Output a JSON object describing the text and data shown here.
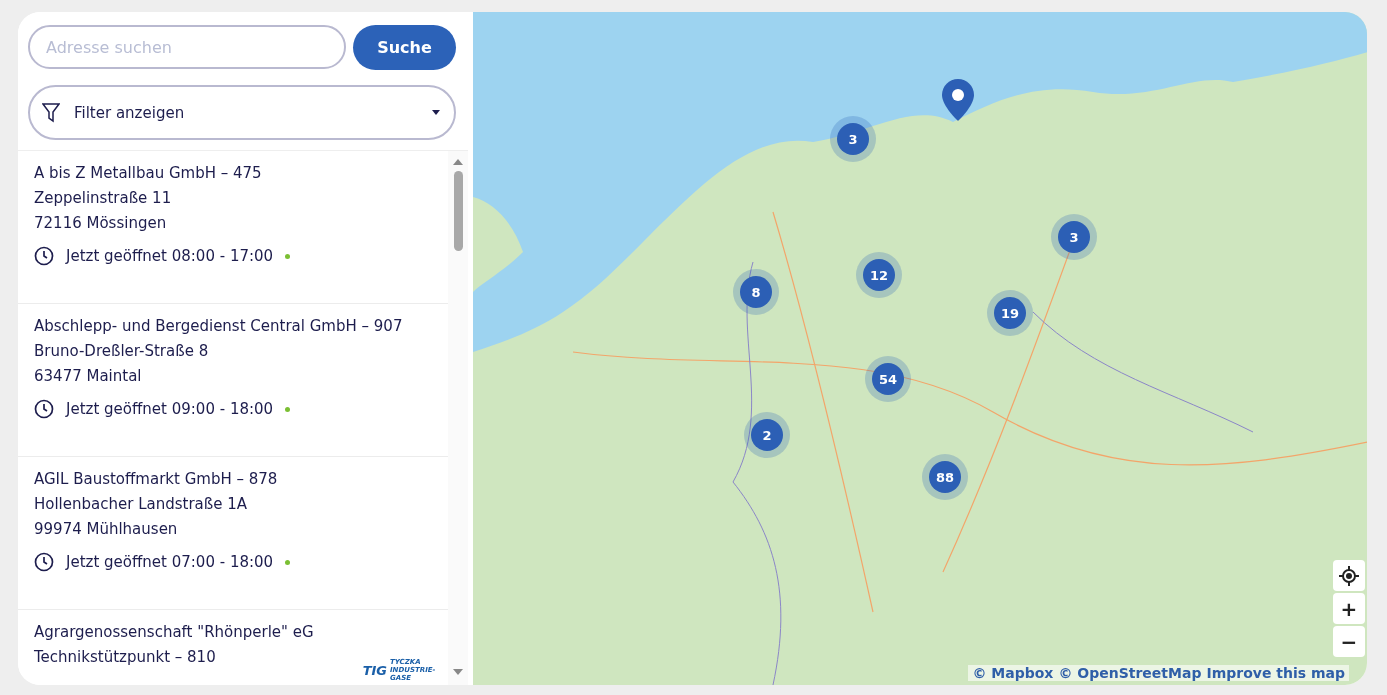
{
  "search": {
    "placeholder": "Adresse suchen",
    "button": "Suche"
  },
  "filter": {
    "label": "Filter anzeigen"
  },
  "locations": [
    {
      "name": "A bis Z Metallbau GmbH – 475",
      "street": "Zeppelinstraße 11",
      "city": "72116 Mössingen",
      "hours": "Jetzt geöffnet 08:00 - 17:00",
      "open": true
    },
    {
      "name": "Abschlepp- und Bergedienst Central GmbH – 907",
      "street": "Bruno-Dreßler-Straße 8",
      "city": "63477 Maintal",
      "hours": "Jetzt geöffnet 09:00 - 18:00",
      "open": true
    },
    {
      "name": "AGIL Baustoffmarkt GmbH – 878",
      "street": "Hollenbacher Landstraße 1A",
      "city": "99974 Mühlhausen",
      "hours": "Jetzt geöffnet 07:00 - 18:00",
      "open": true
    },
    {
      "name": "Agrargenossenschaft \"Rhönperle\" eG",
      "street": "Technikstützpunkt – 810",
      "logo": {
        "mark": "TIG",
        "text": "TYCZKA INDUSTRIE-GASE"
      }
    }
  ],
  "map": {
    "clusters": [
      "3",
      "3",
      "12",
      "8",
      "19",
      "54",
      "2",
      "88"
    ],
    "controls": [
      "+",
      "−"
    ],
    "attribution": [
      "© Mapbox",
      "© OpenStreetMap",
      "Improve this map"
    ]
  }
}
